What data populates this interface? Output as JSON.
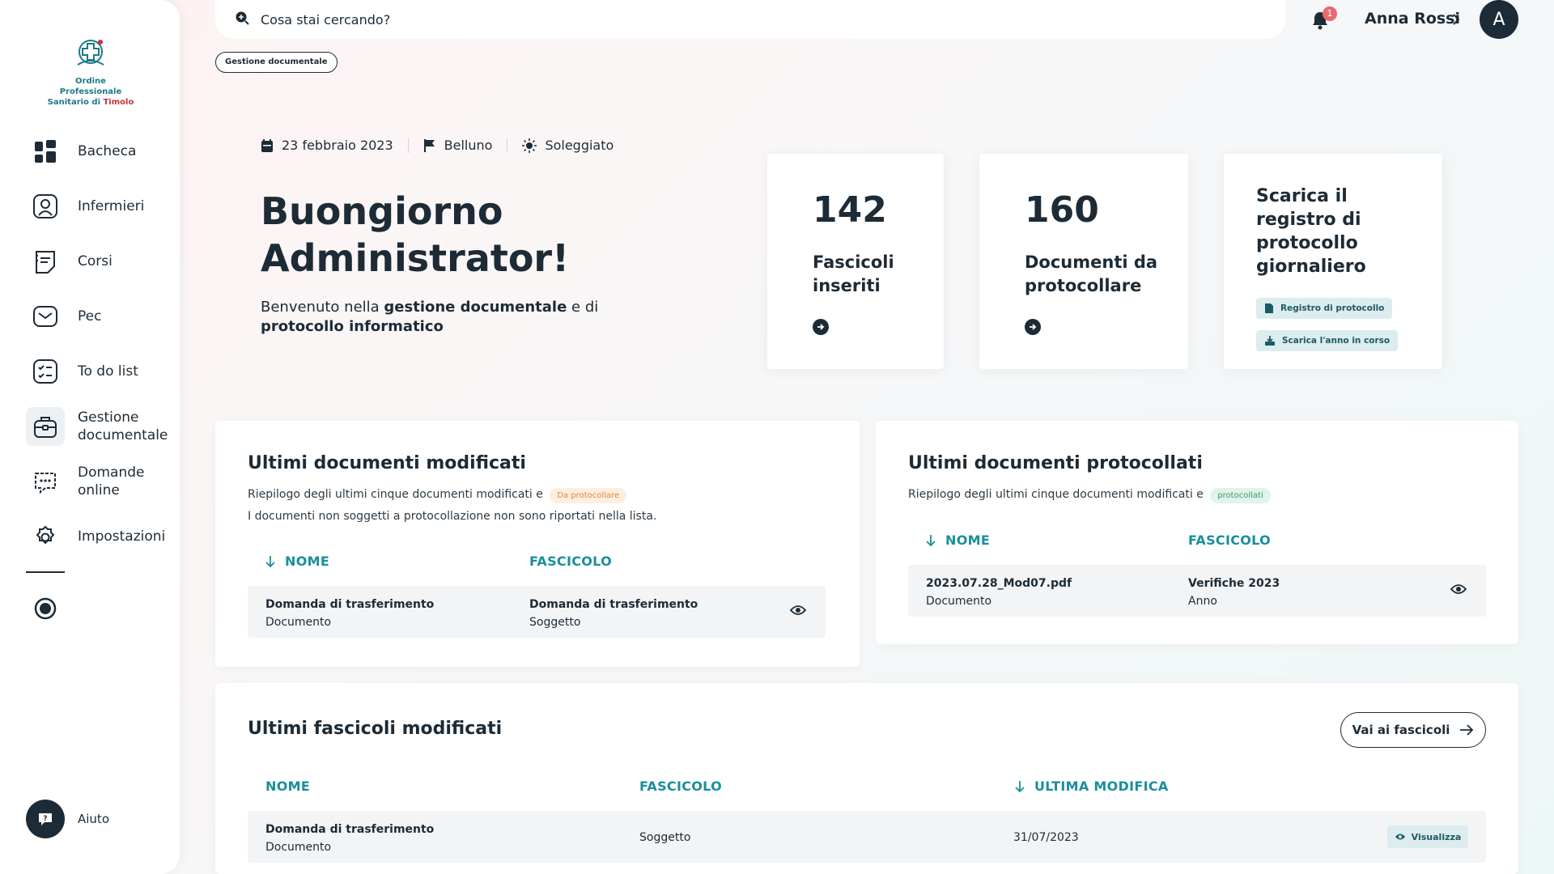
{
  "sidebar": {
    "logo": {
      "line1": "Ordine Professionale",
      "line2a": "Sanitario di ",
      "line2b": "Timolo"
    },
    "items": [
      {
        "label": "Bacheca"
      },
      {
        "label": "Infermieri"
      },
      {
        "label": "Corsi"
      },
      {
        "label": "Pec"
      },
      {
        "label": "To do list"
      },
      {
        "label": "Gestione documentale"
      },
      {
        "label": "Domande online"
      },
      {
        "label": "Impostazioni"
      }
    ],
    "help_label": "Aiuto"
  },
  "header": {
    "search_placeholder": "Cosa stai cercando?",
    "notification_count": "1",
    "user_name": "Anna Rossi",
    "avatar_initial": "A"
  },
  "breadcrumb": "Gestione documentale",
  "meta": {
    "date": "23 febbraio 2023",
    "location": "Belluno",
    "weather": "Soleggiato"
  },
  "hero": {
    "greeting": "Buongiorno Administrator!",
    "welcome_pre": "Benvenuto nella ",
    "welcome_b1": "gestione documentale",
    "welcome_mid": " e di ",
    "welcome_b2": "protocollo informatico"
  },
  "stats": [
    {
      "value": "142",
      "label": "Fascicoli inseriti"
    },
    {
      "value": "160",
      "label": "Documenti da protocollare"
    }
  ],
  "download_card": {
    "title": "Scarica il registro di protocollo giornaliero",
    "chip1": "Registro di protocollo",
    "chip2": "Scarica l'anno in corso"
  },
  "modified_docs": {
    "title": "Ultimi documenti modificati",
    "desc": "Riepilogo degli ultimi cinque documenti modificati e",
    "tag": "Da protocollare",
    "note": "I documenti non soggetti a protocollazione non sono riportati nella lista.",
    "col_name": "NOME",
    "col_folder": "FASCICOLO",
    "rows": [
      {
        "name": "Domanda di trasferimento",
        "name_sub": "Documento",
        "folder": "Domanda di trasferimento",
        "folder_sub": "Soggetto"
      }
    ]
  },
  "protocol_docs": {
    "title": "Ultimi documenti protocollati",
    "desc": "Riepilogo degli ultimi cinque documenti modificati e",
    "tag": "protocollati",
    "col_name": "NOME",
    "col_folder": "FASCICOLO",
    "rows": [
      {
        "name": "2023.07.28_Mod07.pdf",
        "name_sub": "Documento",
        "folder": "Verifiche 2023",
        "folder_sub": "Anno"
      }
    ]
  },
  "folders": {
    "title": "Ultimi fascicoli modificati",
    "button": "Vai ai fascicoli",
    "col_name": "NOME",
    "col_folder": "FASCICOLO",
    "col_modified": "ULTIMA MODIFICA",
    "rows": [
      {
        "name": "Domanda di trasferimento",
        "name_sub": "Documento",
        "folder": "Soggetto",
        "modified": "31/07/2023",
        "action": "Visualizza"
      }
    ]
  },
  "colors": {
    "primary": "#1d2b36",
    "accent": "#1a8e9c",
    "badge": "#e96a70"
  }
}
